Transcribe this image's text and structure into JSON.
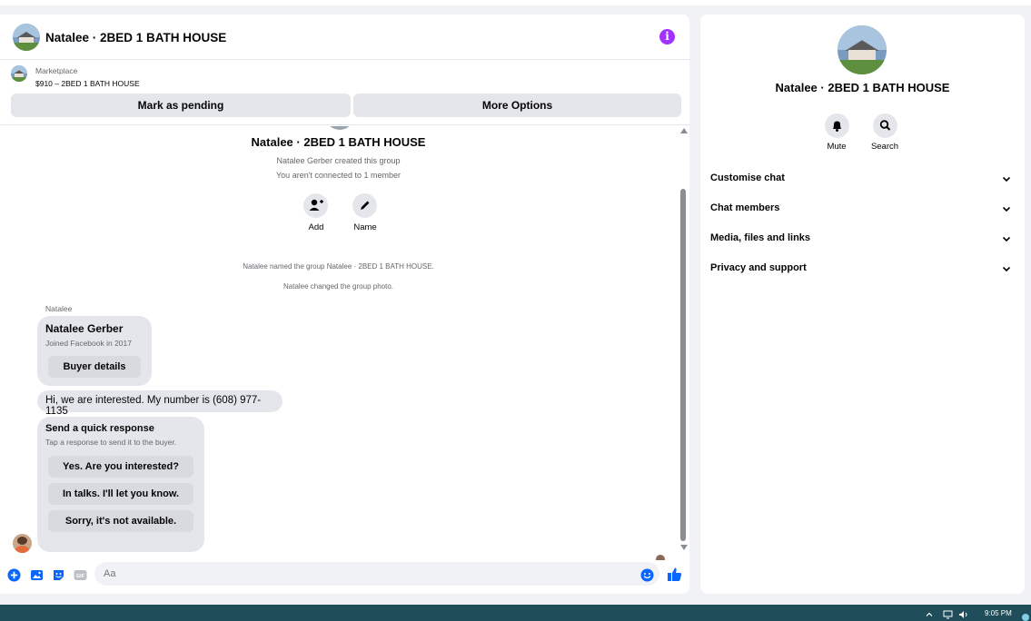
{
  "header": {
    "title": "Natalee · 2BED 1 BATH HOUSE",
    "info_icon": "info-icon",
    "accent_color": "#a033ff"
  },
  "marketplace": {
    "label": "Marketplace",
    "listing": "$910 – 2BED 1 BATH HOUSE",
    "mark_pending": "Mark as pending",
    "more_options": "More Options"
  },
  "thread": {
    "group_title": "Natalee · 2BED 1 BATH HOUSE",
    "created": "Natalee Gerber created this group",
    "not_connected": "You aren't connected to 1 member",
    "add_label": "Add",
    "name_label": "Name",
    "sys_named": "Natalee named the group Natalee · 2BED 1 BATH HOUSE.",
    "sys_photo": "Natalee changed the group photo.",
    "sender": "Natalee",
    "profile_card": {
      "name": "Natalee Gerber",
      "joined": "Joined Facebook in 2017",
      "button": "Buyer details"
    },
    "message": "Hi, we are interested. My number is (608) 977-1135",
    "quick_response": {
      "title": "Send a quick response",
      "subtitle": "Tap a response to send it to the buyer.",
      "options": [
        "Yes. Are you interested?",
        "In talks. I'll let you know.",
        "Sorry, it's not available."
      ]
    }
  },
  "composer": {
    "placeholder": "Aa",
    "icons": [
      "plus-icon",
      "photo-icon",
      "sticker-icon",
      "gif-icon",
      "emoji-icon",
      "like-icon"
    ],
    "accent_color": "#0866ff"
  },
  "panel": {
    "title": "Natalee · 2BED 1 BATH HOUSE",
    "mute_label": "Mute",
    "search_label": "Search",
    "sections": [
      "Customise chat",
      "Chat members",
      "Media, files and links",
      "Privacy and support"
    ]
  },
  "taskbar": {
    "time": "9:05 PM"
  }
}
